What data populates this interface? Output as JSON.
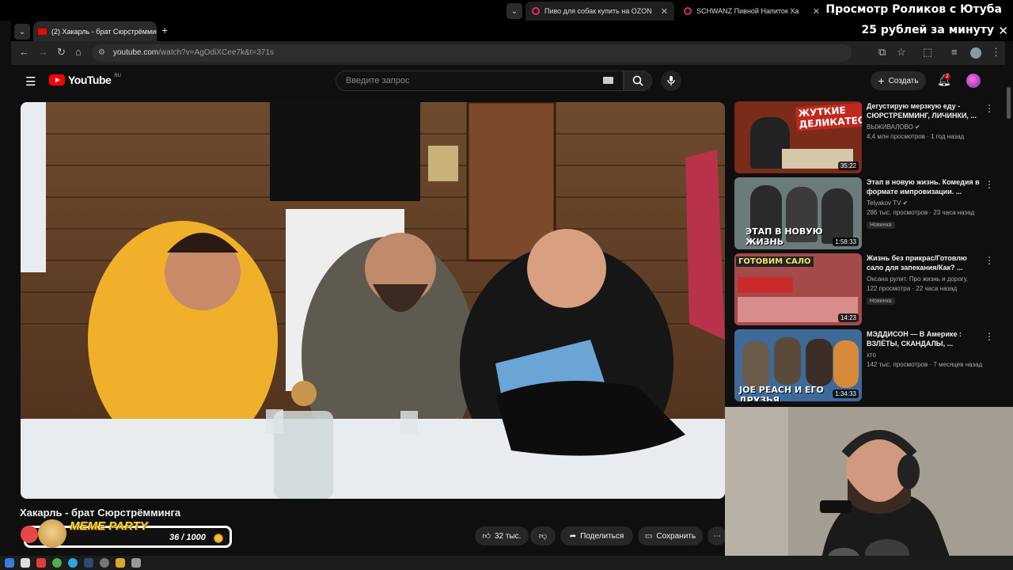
{
  "browser": {
    "tabs_top": [
      {
        "label": "Пиво для собак купить на OZON"
      },
      {
        "label": "SCHWANZ Пивной Напиток Ха"
      }
    ],
    "active_tab": "(2) Хакарль - брат Сюрстрёмминга",
    "url_host": "youtube.com",
    "url_path": "/watch?v=AgOdiXCee7k&t=371s"
  },
  "stream_overlay": {
    "line1": "Просмотр Роликов с Ютуба",
    "line2": "25 рублей за минуту",
    "close": "✕"
  },
  "youtube": {
    "logo_text": "YouTube",
    "logo_region": "RU",
    "search_placeholder": "Введите запрос",
    "create_label": "Создать",
    "notifications_count": "2"
  },
  "video": {
    "title": "Хакарль - брат Сюрстрёмминга",
    "likes": "32 тыс.",
    "share_label": "Поделиться",
    "save_label": "Сохранить"
  },
  "meme_widget": {
    "label": "MEME PARTY",
    "count": "36 / 1000"
  },
  "recommendations": [
    {
      "title": "Дегустирую мерзкую еду - СЮРСТРЕММИНГ, ЛИЧИНКИ, ...",
      "channel": "ВЫЖИВАЛОВО",
      "verified": true,
      "views": "4,4 млн просмотров · 1 год назад",
      "new": "",
      "duration": "35:22",
      "thumb_text": "ЖУТКИЕ ДЕЛИКАТЕСЫ",
      "thumb_color": "#7a2b1a"
    },
    {
      "title": "Этап в новую жизнь. Комедия в формате импровизации. ...",
      "channel": "Telyakov TV",
      "verified": true,
      "views": "286 тыс. просмотров · 23 часа назад",
      "new": "Новинка",
      "duration": "1:58:33",
      "thumb_text": "ЭТАП В НОВУЮ ЖИЗНЬ",
      "thumb_color": "#6b7a7a"
    },
    {
      "title": "Жизнь без прикрас/Готовлю сало для запекания/Как? ...",
      "channel": "Оксана рулит. Про жизнь и дорогу.",
      "verified": false,
      "views": "122 просмотра · 22 часа назад",
      "new": "Новинка",
      "duration": "14:23",
      "thumb_text": "ГОТОВИМ САЛО",
      "thumb_color": "#a54a4a"
    },
    {
      "title": "МЭДДИСОН — В Америке : ВЗЛЁТЫ, СКАНДАЛЫ, ...",
      "channel": "хто",
      "verified": false,
      "views": "142 тыс. просмотров · 7 месяцев назад",
      "new": "",
      "duration": "1:34:33",
      "thumb_text": "JOE PEACH И ЕГО ДРУЗЬЯ",
      "thumb_color": "#3e6a9a"
    }
  ]
}
